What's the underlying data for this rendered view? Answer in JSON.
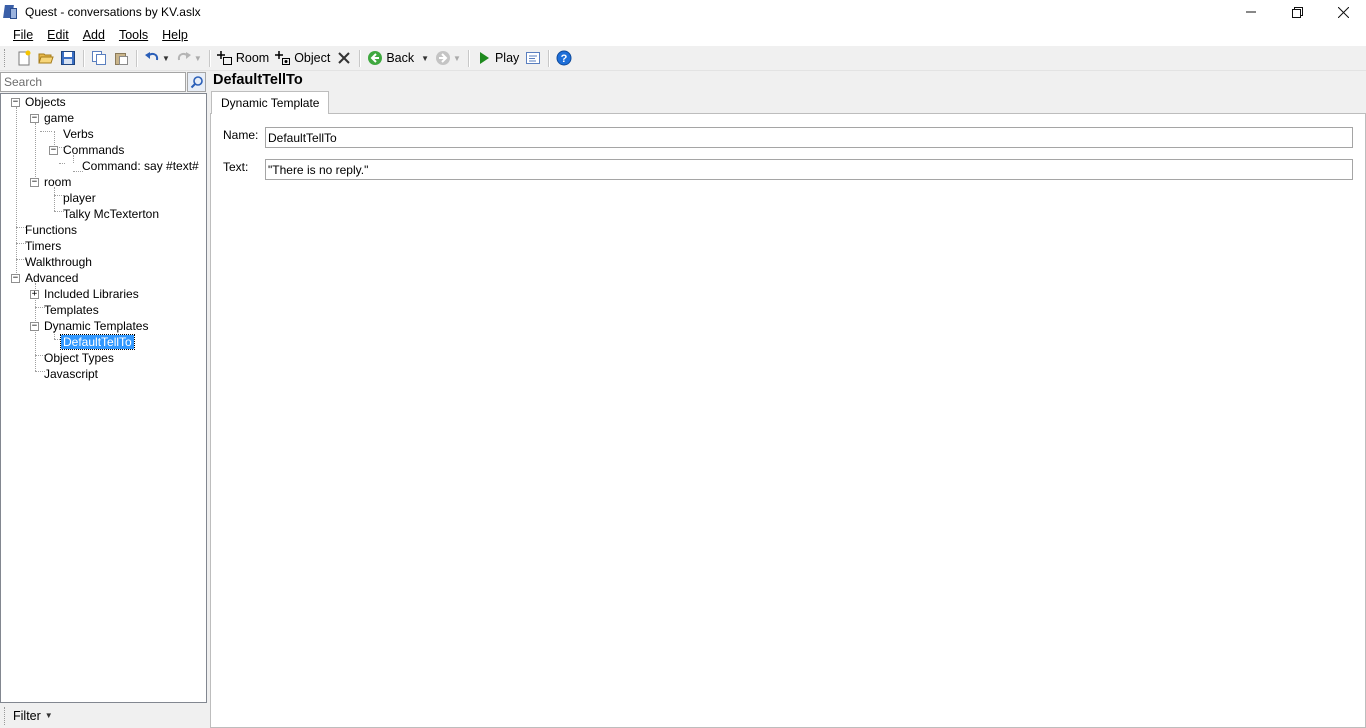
{
  "window": {
    "title": "Quest - conversations by KV.aslx",
    "minimize_glyph": "—",
    "restore_glyph": "❐",
    "close_glyph": "✕"
  },
  "menu": {
    "items": [
      {
        "label": "File"
      },
      {
        "label": "Edit"
      },
      {
        "label": "Add"
      },
      {
        "label": "Tools"
      },
      {
        "label": "Help"
      }
    ]
  },
  "toolbar": {
    "room_label": "Room",
    "object_label": "Object",
    "back_label": "Back",
    "play_label": "Play",
    "icons": [
      "new-file-icon",
      "open-folder-icon",
      "save-icon",
      "copy-icon",
      "paste-icon",
      "undo-icon",
      "redo-icon",
      "add-room-icon",
      "add-object-icon",
      "delete-icon",
      "back-icon",
      "forward-icon",
      "play-icon",
      "code-view-icon",
      "help-icon"
    ],
    "colors": {
      "back": "#3fa83f",
      "play": "#1e8a1e",
      "help": "#1e6fd9",
      "delete": "#333333"
    }
  },
  "search": {
    "placeholder": "Search"
  },
  "tree": {
    "items": [
      {
        "label": "Objects"
      },
      {
        "label": "game"
      },
      {
        "label": "Verbs"
      },
      {
        "label": "Commands"
      },
      {
        "label": "Command: say #text#"
      },
      {
        "label": "room"
      },
      {
        "label": "player"
      },
      {
        "label": "Talky McTexterton"
      },
      {
        "label": "Functions"
      },
      {
        "label": "Timers"
      },
      {
        "label": "Walkthrough"
      },
      {
        "label": "Advanced"
      },
      {
        "label": "Included Libraries"
      },
      {
        "label": "Templates"
      },
      {
        "label": "Dynamic Templates"
      },
      {
        "label": "DefaultTellTo"
      },
      {
        "label": "Object Types"
      },
      {
        "label": "Javascript"
      }
    ],
    "selected": "DefaultTellTo",
    "selection_color": "#3399ff"
  },
  "filter": {
    "label": "Filter"
  },
  "editor": {
    "title": "DefaultTellTo",
    "tab_label": "Dynamic Template",
    "name_label": "Name:",
    "name_value": "DefaultTellTo",
    "text_label": "Text:",
    "text_value": "\"There is no reply.\""
  }
}
